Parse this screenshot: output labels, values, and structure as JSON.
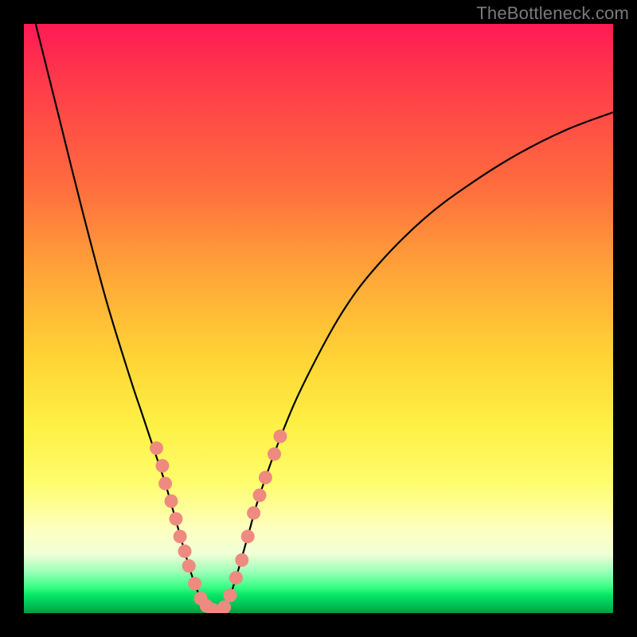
{
  "watermark": "TheBottleneck.com",
  "colors": {
    "frame": "#000000",
    "gradient_top": "#ff1a55",
    "gradient_mid": "#fef044",
    "gradient_bottom": "#009d3c",
    "curve": "#000000",
    "marker": "#ef8a80"
  },
  "chart_data": {
    "type": "line",
    "title": "",
    "xlabel": "",
    "ylabel": "",
    "xlim": [
      0,
      100
    ],
    "ylim": [
      0,
      100
    ],
    "description": "Bottleneck-style V curve. X is an unlabeled parameter (0–100 across plot width). Y is an unlabeled score (0 at bottom = good/green, 100 at top = bad/red). Two curves descend to a shared minimum near x≈30 at the bottom of the plot.",
    "series": [
      {
        "name": "left-curve",
        "x": [
          2,
          6,
          10,
          14,
          18,
          20,
          22,
          24,
          26,
          28,
          29,
          30,
          31,
          32,
          33
        ],
        "y": [
          100,
          84,
          68,
          53,
          40,
          34,
          28,
          22,
          15,
          8,
          5,
          2.5,
          1.2,
          0.6,
          0.3
        ]
      },
      {
        "name": "right-curve",
        "x": [
          33,
          34,
          35,
          36,
          38,
          40,
          44,
          48,
          54,
          60,
          68,
          76,
          84,
          92,
          100
        ],
        "y": [
          0.3,
          1,
          3,
          6,
          13,
          20,
          31,
          40,
          51,
          59,
          67,
          73,
          78,
          82,
          85
        ]
      }
    ],
    "markers": {
      "name": "highlighted-points",
      "points": [
        {
          "x": 22.5,
          "y": 28
        },
        {
          "x": 23.5,
          "y": 25
        },
        {
          "x": 24.0,
          "y": 22
        },
        {
          "x": 25.0,
          "y": 19
        },
        {
          "x": 25.8,
          "y": 16
        },
        {
          "x": 26.5,
          "y": 13
        },
        {
          "x": 27.3,
          "y": 10.5
        },
        {
          "x": 28.0,
          "y": 8
        },
        {
          "x": 29.0,
          "y": 5
        },
        {
          "x": 30.0,
          "y": 2.5
        },
        {
          "x": 31.0,
          "y": 1.2
        },
        {
          "x": 32.0,
          "y": 0.6
        },
        {
          "x": 33.0,
          "y": 0.3
        },
        {
          "x": 34.0,
          "y": 1
        },
        {
          "x": 35.0,
          "y": 3
        },
        {
          "x": 36.0,
          "y": 6
        },
        {
          "x": 37.0,
          "y": 9
        },
        {
          "x": 38.0,
          "y": 13
        },
        {
          "x": 39.0,
          "y": 17
        },
        {
          "x": 40.0,
          "y": 20
        },
        {
          "x": 41.0,
          "y": 23
        },
        {
          "x": 42.5,
          "y": 27
        },
        {
          "x": 43.5,
          "y": 30
        }
      ]
    }
  }
}
